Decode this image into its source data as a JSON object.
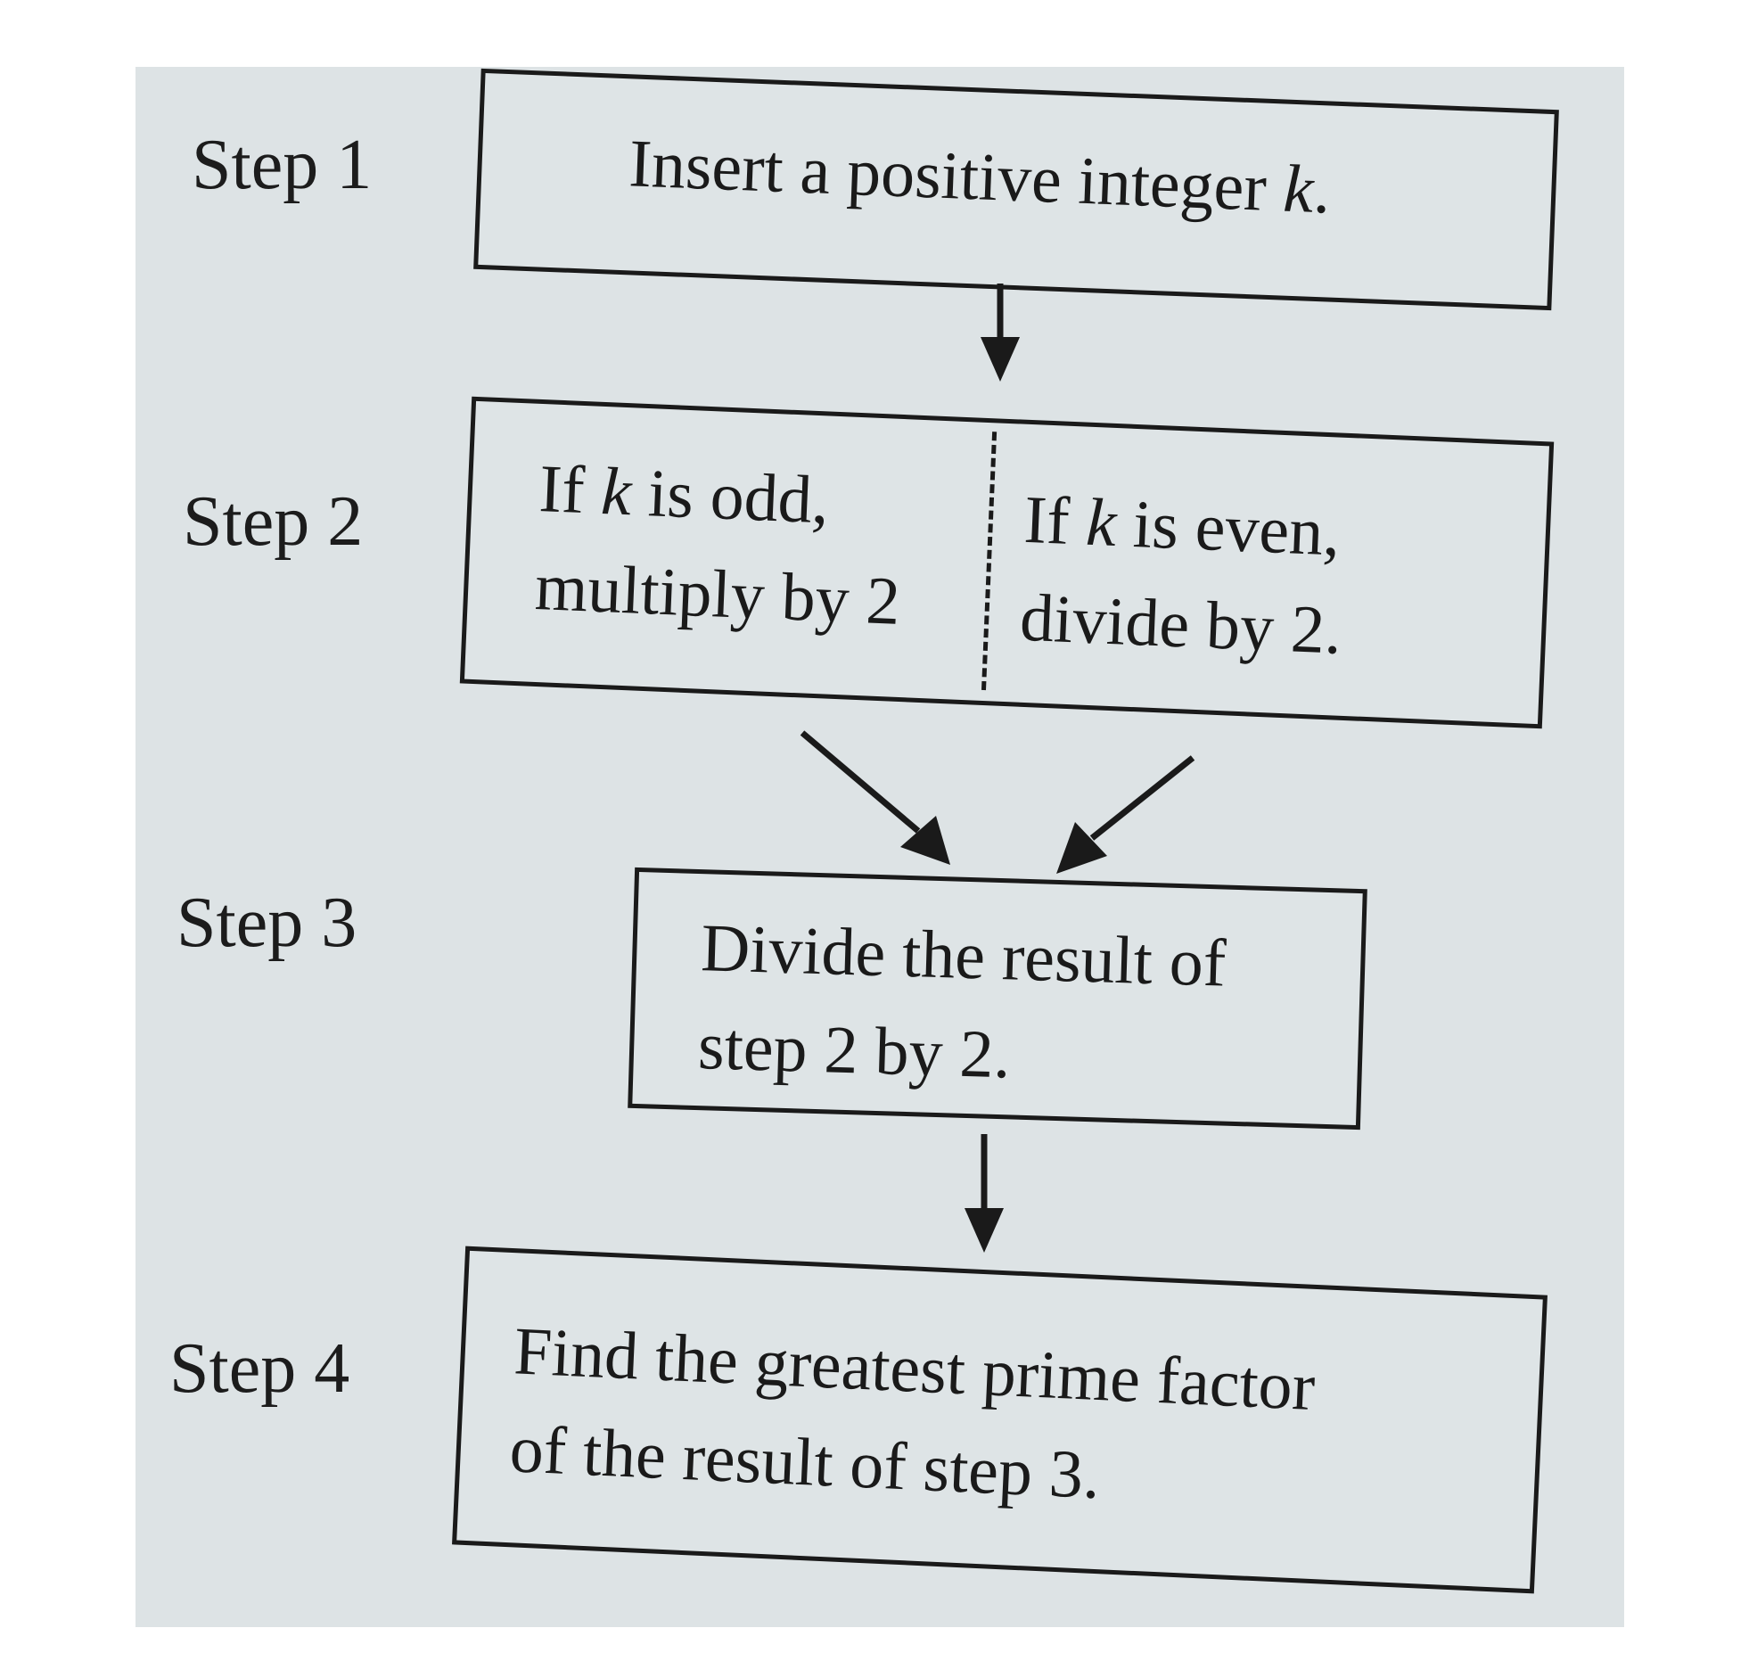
{
  "steps": [
    {
      "label": "Step 1",
      "text": "Insert a positive integer",
      "var": "k",
      "suffix": "."
    },
    {
      "label": "Step 2",
      "left": {
        "line1_prefix": "If",
        "var": "k",
        "line1_suffix": "is odd,",
        "line2": "multiply by 2"
      },
      "right": {
        "line1_prefix": "If",
        "var": "k",
        "line1_suffix": "is even,",
        "line2": "divide by 2."
      }
    },
    {
      "label": "Step 3",
      "line1": "Divide the result of",
      "line2": "step 2 by 2."
    },
    {
      "label": "Step 4",
      "line1": "Find the greatest prime factor",
      "line2": "of the result of step 3."
    }
  ]
}
